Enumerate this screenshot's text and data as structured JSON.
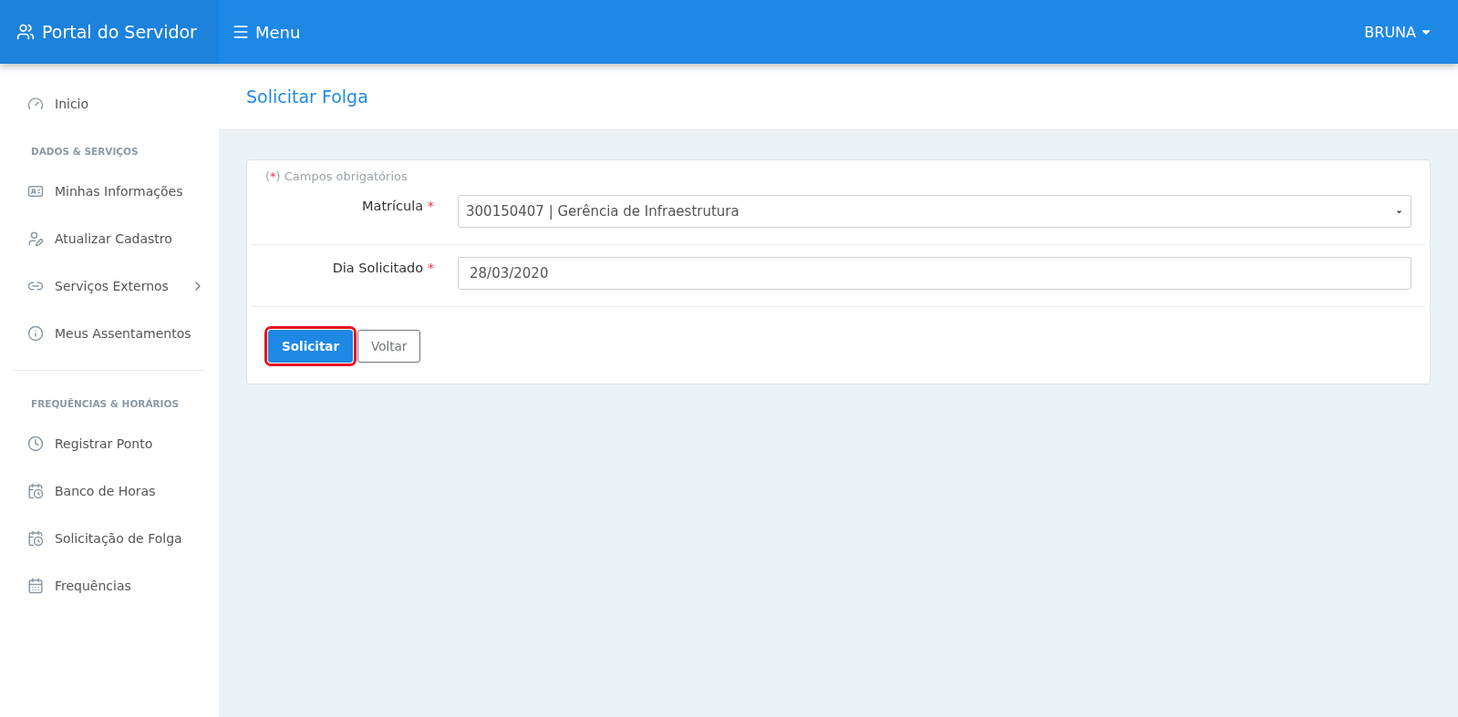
{
  "topbar": {
    "brand": "Portal do Servidor",
    "menu": "Menu",
    "user": "BRUNA"
  },
  "sidebar": {
    "sections": [
      {
        "items": [
          {
            "label": "Inicio",
            "has_submenu": false
          }
        ]
      },
      {
        "heading": "DADOS & SERVIÇOS",
        "divider_after": true,
        "items": [
          {
            "label": "Minhas Informações",
            "has_submenu": false
          },
          {
            "label": "Atualizar Cadastro",
            "has_submenu": false
          },
          {
            "label": "Serviços Externos",
            "has_submenu": true
          },
          {
            "label": "Meus Assentamentos",
            "has_submenu": false
          }
        ]
      },
      {
        "heading": "FREQUÊNCIAS & HORÁRIOS",
        "divider_after": false,
        "items": [
          {
            "label": "Registrar Ponto",
            "has_submenu": false
          },
          {
            "label": "Banco de Horas",
            "has_submenu": false
          },
          {
            "label": "Solicitação de Folga",
            "has_submenu": false
          },
          {
            "label": "Frequências",
            "has_submenu": false
          }
        ]
      }
    ]
  },
  "page": {
    "title": "Solicitar Folga"
  },
  "form": {
    "note": {
      "open": "(",
      "mark": "*",
      "close": ")",
      "text": "Campos obrigatórios"
    },
    "fields": [
      {
        "kind": "select",
        "label": "Matrícula",
        "mark": "*",
        "value": "300150407 | Gerência de Infraestrutura"
      },
      {
        "kind": "input",
        "label": "Dia Solicitado",
        "mark": "*",
        "value": "28/03/2020"
      }
    ],
    "buttons": [
      {
        "label": "Solicitar",
        "kind": "primary",
        "highlighted": true
      },
      {
        "label": "Voltar",
        "kind": "secondary",
        "highlighted": false
      }
    ]
  }
}
